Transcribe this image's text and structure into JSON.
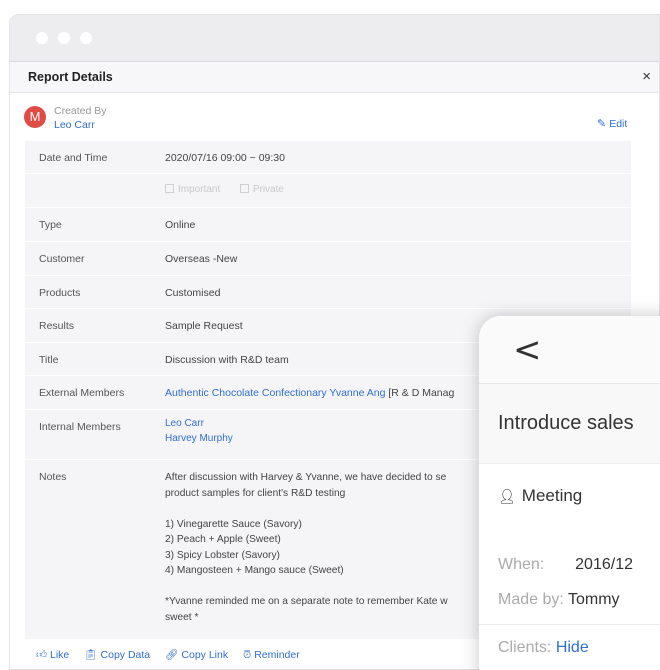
{
  "dialog": {
    "title": "Report Details",
    "close": "×"
  },
  "creator": {
    "avatar_letter": "M",
    "label": "Created By",
    "name": "Leo Carr"
  },
  "edit_label": "Edit",
  "rows": {
    "date": {
      "label": "Date and Time",
      "value": "2020/07/16 09:00 ~ 09:30"
    },
    "flags": {
      "important": "Important",
      "private": "Private"
    },
    "type": {
      "label": "Type",
      "value": "Online"
    },
    "customer": {
      "label": "Customer",
      "value": "Overseas -New"
    },
    "products": {
      "label": "Products",
      "value": "Customised"
    },
    "results": {
      "label": "Results",
      "value": "Sample Request"
    },
    "title": {
      "label": "Title",
      "value": "Discussion with R&D team"
    },
    "external": {
      "label": "External Members",
      "link": "Authentic Chocolate Confectionary Yvanne Ang",
      "extra": " [R & D Manag"
    },
    "internal": {
      "label": "Internal Members",
      "members": [
        "Leo Carr",
        "Harvey Murphy"
      ]
    },
    "notes": {
      "label": "Notes",
      "lines": [
        "After discussion with  Harvey  & Yvanne, we have decided to se",
        "product samples for client's R&D testing",
        "",
        "1) Vinegarette Sauce (Savory)",
        "2) Peach + Apple (Sweet)",
        "3) Spicy Lobster (Savory)",
        "4) Mangosteen + Mango sauce (Sweet)",
        "",
        "*Yvanne reminded me on a separate note to remember Kate w",
        "sweet *"
      ]
    }
  },
  "actions": {
    "like": "Like",
    "copy_data": "Copy Data",
    "copy_link": "Copy Link",
    "reminder": "Reminder"
  },
  "phone": {
    "back": "<",
    "title": "Introduce sales",
    "meeting": "Meeting",
    "when_label": "When:",
    "when_value": "2016/12",
    "madeby_label": "Made by:",
    "madeby_value": "Tommy",
    "clients_label": "Clients:",
    "clients_value": "Hide"
  },
  "colors": {
    "accent": "#2f6fd1",
    "avatar": "#e04b45",
    "row_bg": "#f5f5f7"
  }
}
